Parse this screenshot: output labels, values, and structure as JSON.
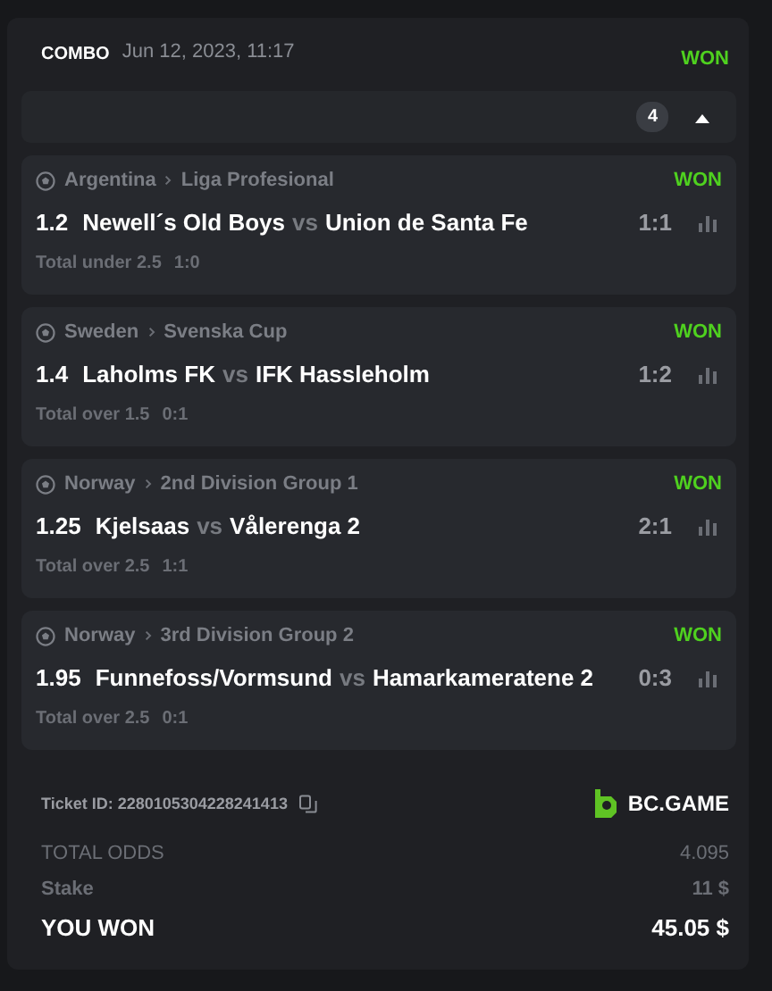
{
  "header": {
    "type": "COMBO",
    "date": "Jun 12, 2023, 11:17",
    "status": "WON"
  },
  "legs_bar": {
    "count": "4",
    "expanded": true
  },
  "legs": [
    {
      "country": "Argentina",
      "league": "Liga Profesional",
      "status": "WON",
      "odds": "1.2",
      "home": "Newell´s Old Boys",
      "vs": "vs",
      "away": "Union de Santa Fe",
      "score": "1:1",
      "market": "Total under 2.5",
      "result": "1:0"
    },
    {
      "country": "Sweden",
      "league": "Svenska Cup",
      "status": "WON",
      "odds": "1.4",
      "home": "Laholms FK",
      "vs": "vs",
      "away": "IFK Hassleholm",
      "score": "1:2",
      "market": "Total over 1.5",
      "result": "0:1"
    },
    {
      "country": "Norway",
      "league": "2nd Division Group 1",
      "status": "WON",
      "odds": "1.25",
      "home": "Kjelsaas",
      "vs": "vs",
      "away": "Vålerenga 2",
      "score": "2:1",
      "market": "Total over 2.5",
      "result": "1:1"
    },
    {
      "country": "Norway",
      "league": "3rd Division Group 2",
      "status": "WON",
      "odds": "1.95",
      "home": "Funnefoss/Vormsund",
      "vs": "vs",
      "away": "Hamarkameratene 2",
      "score": "0:3",
      "market": "Total over 2.5",
      "result": "0:1"
    }
  ],
  "ticket": {
    "label": "Ticket ID:",
    "id": "2280105304228241413",
    "brand": "BC.GAME"
  },
  "totals": [
    {
      "kind": "muted",
      "label": "TOTAL ODDS",
      "value": "4.095"
    },
    {
      "kind": "bold-muted",
      "label": "Stake",
      "value": "11 $"
    },
    {
      "kind": "highlight",
      "label": "YOU WON",
      "value": "45.05 $"
    }
  ]
}
